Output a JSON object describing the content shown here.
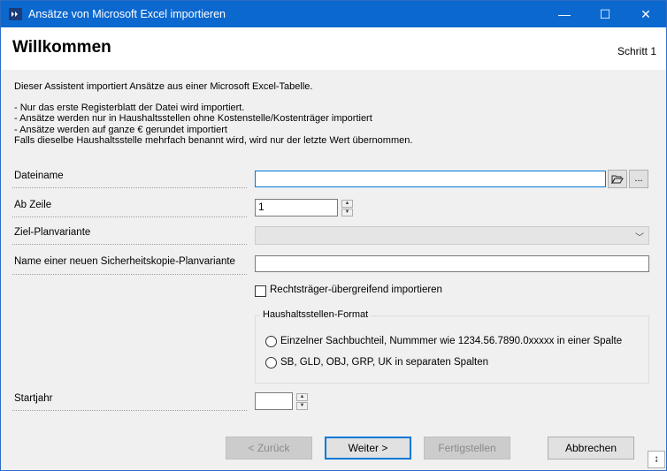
{
  "window": {
    "title": "Ansätze von Microsoft Excel importieren",
    "minimize_glyph": "—",
    "maximize_glyph": "☐",
    "close_glyph": "✕",
    "title_bar_color": "#0b68cf"
  },
  "header": {
    "title": "Willkommen",
    "step": "Schritt 1"
  },
  "description": {
    "intro": "Dieser Assistent importiert Ansätze aus einer Microsoft Excel-Tabelle.",
    "bullet1": "- Nur das erste Registerblatt der Datei wird importiert.",
    "bullet2": "- Ansätze werden nur in Haushaltsstellen ohne Kostenstelle/Kostenträger importiert",
    "bullet3": "- Ansätze werden auf ganze € gerundet importiert",
    "note": "Falls dieselbe Haushaltsstelle mehrfach benannt wird, wird nur der letzte Wert übernommen."
  },
  "form": {
    "dateiname_label": "Dateiname",
    "dateiname_value": "",
    "browse_icon": "folder-open-icon",
    "ellipsis_label": "...",
    "ab_zeile_label": "Ab Zeile",
    "ab_zeile_value": "1",
    "ziel_label": "Ziel-Planvariante",
    "ziel_value": "",
    "sicherheit_label": "Name einer neuen Sicherheitskopie-Planvariante",
    "sicherheit_value": "",
    "checkbox_label": "Rechtsträger-übergreifend importieren",
    "group_title": "Haushaltsstellen-Format",
    "radio1_label": "Einzelner Sachbuchteil, Nummmer wie 1234.56.7890.0xxxxx in einer Spalte",
    "radio2_label": "SB, GLD, OBJ, GRP, UK in separaten Spalten",
    "startjahr_label": "Startjahr",
    "startjahr_value": ""
  },
  "buttons": {
    "back": "< Zurück",
    "next": "Weiter >",
    "finish": "Fertigstellen",
    "cancel": "Abbrechen"
  },
  "accent_color": "#0078d7"
}
